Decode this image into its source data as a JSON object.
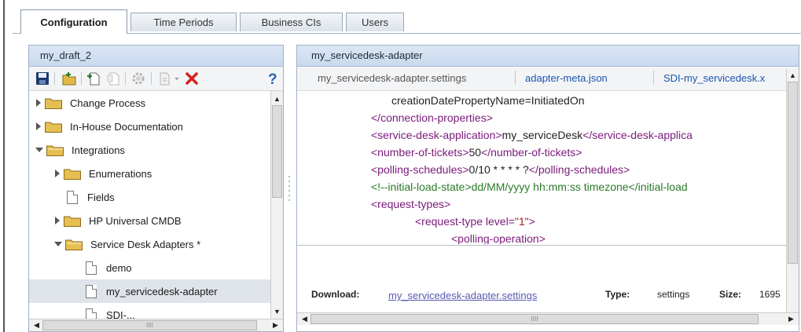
{
  "tabs": [
    {
      "label": "Configuration",
      "active": true
    },
    {
      "label": "Time Periods",
      "active": false
    },
    {
      "label": "Business CIs",
      "active": false
    },
    {
      "label": "Users",
      "active": false
    }
  ],
  "left_pane": {
    "title": "my_draft_2",
    "tree": [
      {
        "label": "Change Process",
        "type": "folder",
        "expanded": false
      },
      {
        "label": "In-House Documentation",
        "type": "folder",
        "expanded": false
      },
      {
        "label": "Integrations",
        "type": "folder",
        "expanded": true
      },
      {
        "label": "Enumerations",
        "type": "folder",
        "expanded": false
      },
      {
        "label": "Fields",
        "type": "file"
      },
      {
        "label": "HP Universal CMDB",
        "type": "folder",
        "expanded": false
      },
      {
        "label": "Service Desk Adapters *",
        "type": "folder",
        "expanded": true
      },
      {
        "label": "demo",
        "type": "file"
      },
      {
        "label": "my_servicedesk-adapter",
        "type": "file",
        "selected": true
      },
      {
        "label": "SDI-...",
        "type": "file"
      }
    ],
    "hscroll_grip": "IIII"
  },
  "right_pane": {
    "title": "my_servicedesk-adapter",
    "doc_tabs": [
      {
        "label": "my_servicedesk-adapter.settings",
        "active": true
      },
      {
        "label": "adapter-meta.json",
        "active": false
      },
      {
        "label": "SDI-my_servicedesk.x",
        "active": false
      }
    ],
    "code_lines": [
      {
        "parts": [
          {
            "t": "creationDatePropertyName=InitiatedOn",
            "c": "txt"
          }
        ]
      },
      {
        "parts": [
          {
            "t": "</connection-properties>",
            "c": "tag"
          }
        ]
      },
      {
        "parts": [
          {
            "t": "<service-desk-application>",
            "c": "tag"
          },
          {
            "t": "my_serviceDesk",
            "c": "txt"
          },
          {
            "t": "</service-desk-applica",
            "c": "tag"
          }
        ]
      },
      {
        "parts": [
          {
            "t": "<number-of-tickets>",
            "c": "tag"
          },
          {
            "t": "50",
            "c": "txt"
          },
          {
            "t": "</number-of-tickets>",
            "c": "tag"
          }
        ]
      },
      {
        "parts": [
          {
            "t": "<polling-schedules>",
            "c": "tag"
          },
          {
            "t": "0/10 * * * * ?",
            "c": "txt"
          },
          {
            "t": "</polling-schedules>",
            "c": "tag"
          }
        ]
      },
      {
        "parts": [
          {
            "t": "<!--initial-load-state>dd/MM/yyyy hh:mm:ss timezone</initial-load",
            "c": "com"
          }
        ]
      },
      {
        "parts": [
          {
            "t": "<request-types>",
            "c": "tag"
          }
        ]
      },
      {
        "parts": [
          {
            "t": "<request-type ",
            "c": "tag"
          },
          {
            "t": "level=",
            "c": "attr"
          },
          {
            "t": "\"1\"",
            "c": "val"
          },
          {
            "t": ">",
            "c": "tag"
          }
        ]
      },
      {
        "parts": [
          {
            "t": "<polling-operation>",
            "c": "tag"
          }
        ]
      }
    ],
    "download": {
      "label": "Download:",
      "link": "my_servicedesk-adapter.settings",
      "type_label": "Type:",
      "type_value": "settings",
      "size_label": "Size:",
      "size_value": "1695"
    },
    "hscroll_grip": "IIII"
  },
  "colors": {
    "header_bg": "#c9d9ee",
    "link": "#1a56b0",
    "tag": "#7a1a7a",
    "comment": "#2a7a2a",
    "delete_red": "#d62020",
    "help_blue": "#2b5fb0"
  }
}
